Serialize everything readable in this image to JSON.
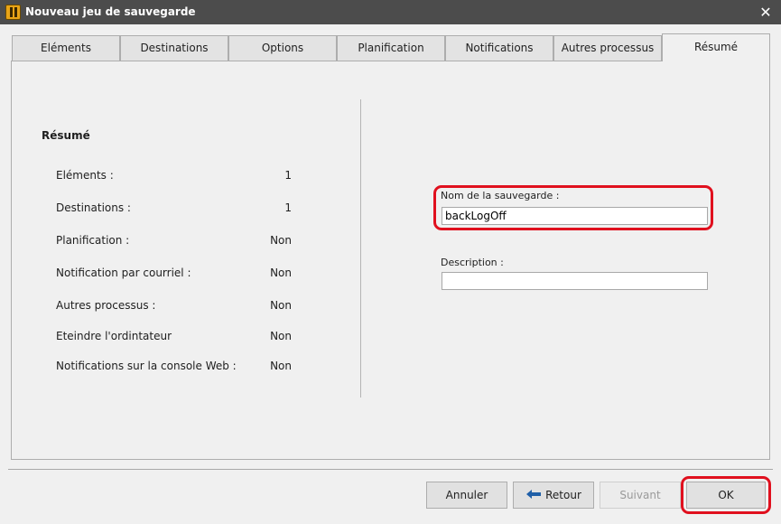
{
  "window": {
    "title": "Nouveau jeu de sauvegarde",
    "close_glyph": "✕"
  },
  "tabs": [
    {
      "label": "Eléments"
    },
    {
      "label": "Destinations"
    },
    {
      "label": "Options"
    },
    {
      "label": "Planification"
    },
    {
      "label": "Notifications"
    },
    {
      "label": "Autres processus"
    },
    {
      "label": "Résumé",
      "active": true
    }
  ],
  "summary": {
    "title": "Résumé",
    "rows": [
      {
        "label": "Eléments :",
        "value": "1"
      },
      {
        "label": "Destinations :",
        "value": "1"
      },
      {
        "label": "Planification :",
        "value": "Non"
      },
      {
        "label": "Notification par courriel :",
        "value": "Non"
      },
      {
        "label": "Autres processus :",
        "value": "Non"
      },
      {
        "label": "Eteindre l'ordintateur",
        "value": "Non"
      },
      {
        "label": "Notifications sur la console Web :",
        "value": "Non"
      }
    ]
  },
  "form": {
    "name_label": "Nom de la sauvegarde :",
    "name_value": "backLogOff",
    "description_label": "Description :",
    "description_value": ""
  },
  "buttons": {
    "cancel": "Annuler",
    "back": "Retour",
    "next": "Suivant",
    "ok": "OK"
  },
  "colors": {
    "titlebar": "#4c4c4c",
    "highlight": "#e0101e",
    "back_arrow": "#1f5fa8"
  },
  "icons": {
    "app": "app-logo-icon",
    "close": "close-icon",
    "back": "arrow-left-icon"
  }
}
